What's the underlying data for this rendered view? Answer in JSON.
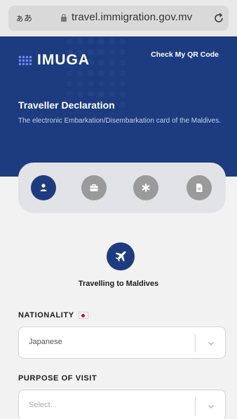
{
  "browser": {
    "text_size_label": "ぁあ",
    "url": "travel.immigration.gov.mv"
  },
  "header": {
    "logo_text": "IMUGA",
    "qr_link": "Check My QR Code",
    "title": "Traveller Declaration",
    "subtitle": "The electronic Embarkation/Disembarkation card of the Maldives."
  },
  "steps": [
    {
      "icon": "person-icon",
      "active": true
    },
    {
      "icon": "briefcase-icon",
      "active": false
    },
    {
      "icon": "asterisk-icon",
      "active": false
    },
    {
      "icon": "document-icon",
      "active": false
    }
  ],
  "main": {
    "section_icon": "airplane-icon",
    "section_title": "Travelling to Maldives",
    "nationality": {
      "label": "NATIONALITY",
      "value": "Japanese"
    },
    "purpose": {
      "label": "PURPOSE OF VISIT",
      "placeholder": "Select..."
    }
  },
  "colors": {
    "brand": "#1d3c80",
    "inactive_step": "#9a9a9a"
  }
}
